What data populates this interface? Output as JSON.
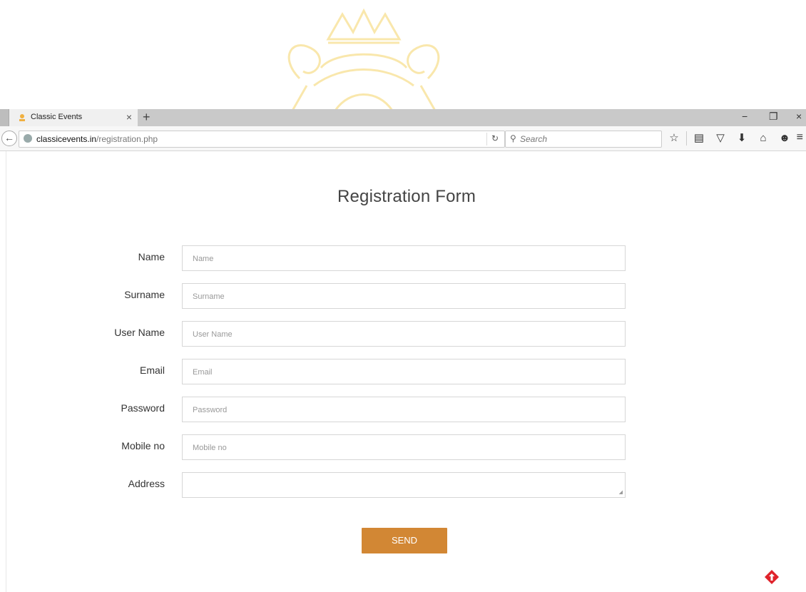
{
  "browser": {
    "tab_title": "Classic Events",
    "tab_close": "×",
    "new_tab": "+",
    "window_controls": {
      "minimize": "−",
      "restore": "❐",
      "close": "×"
    },
    "url_host": "classicevents.in",
    "url_path": "/registration.php",
    "reload": "↻",
    "search_placeholder": "Search",
    "toolbar_icons": [
      "star-icon",
      "reading-list-icon",
      "pocket-icon",
      "download-icon",
      "home-icon",
      "smiley-icon"
    ],
    "toolbar_glyphs": [
      "☆",
      "▤",
      "▽",
      "⬇",
      "⌂",
      "☻"
    ],
    "menu_glyph": "≡"
  },
  "form": {
    "title": "Registration Form",
    "fields": [
      {
        "label": "Name",
        "placeholder": "Name"
      },
      {
        "label": "Surname",
        "placeholder": "Surname"
      },
      {
        "label": "User Name",
        "placeholder": "User Name"
      },
      {
        "label": "Email",
        "placeholder": "Email"
      },
      {
        "label": "Password",
        "placeholder": "Password"
      },
      {
        "label": "Mobile no",
        "placeholder": "Mobile no"
      },
      {
        "label": "Address",
        "placeholder": ""
      }
    ],
    "submit_label": "SEND"
  },
  "colors": {
    "accent": "#d28734",
    "watermark": "#f3c84a",
    "scroll_top": "#e0232b"
  }
}
